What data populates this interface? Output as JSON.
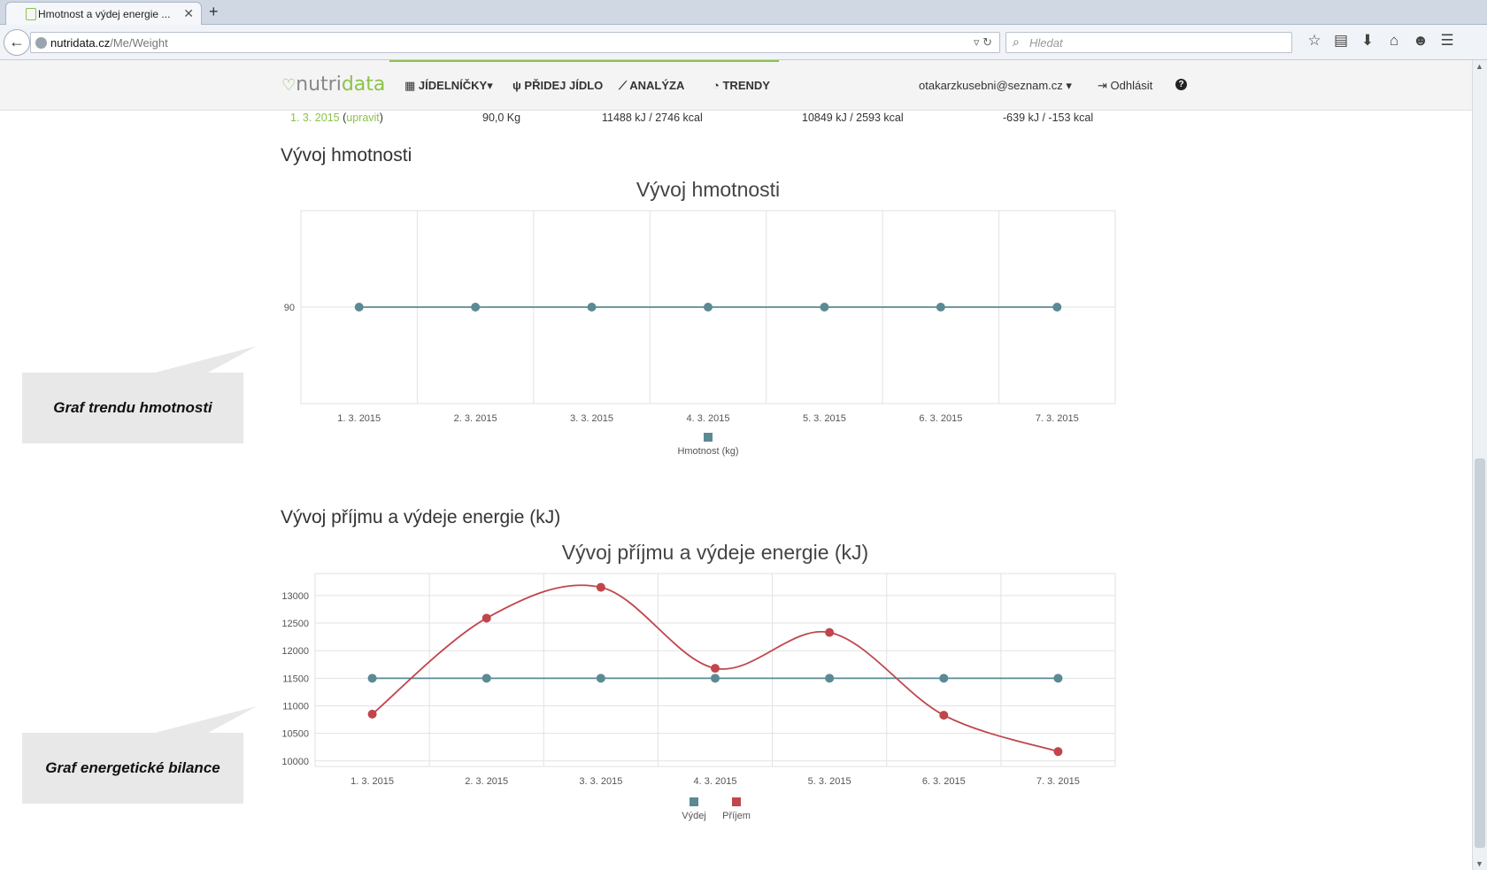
{
  "browser": {
    "tab_title": "Hmotnost a výdej energie ...",
    "tab_close": "✕",
    "new_tab": "+",
    "url_domain": "nutridata.cz",
    "url_path": "/Me/Weight",
    "search_placeholder": "Hledat"
  },
  "header": {
    "logo_text_1": "nutri",
    "logo_text_2": "data",
    "menu": [
      {
        "icon": "calendar-icon",
        "label": "JÍDELNÍČKY"
      },
      {
        "icon": "cutlery-icon",
        "label": "PŘIDEJ JÍDLO"
      },
      {
        "icon": "line-chart-icon",
        "label": "ANALÝZA"
      },
      {
        "icon": "dashboard-icon",
        "label": "TRENDY"
      }
    ],
    "user_email": "otakarzkusebni@seznam.cz",
    "logout_label": "Odhlásit",
    "help": "?"
  },
  "summary_row": {
    "date": "1. 3. 2015",
    "edit_label": "upravit",
    "weight": "90,0 Kg",
    "intake": "11488 kJ / 2746 kcal",
    "expenditure": "10849 kJ / 2593 kcal",
    "balance": "-639 kJ / -153 kcal"
  },
  "callouts": {
    "weight": "Graf trendu hmotnosti",
    "energy": "Graf energetické bilance"
  },
  "sections": {
    "weight_title": "Vývoj hmotnosti",
    "energy_title": "Vývoj příjmu a výdeje energie (kJ)"
  },
  "chart_data": [
    {
      "type": "line",
      "title": "Vývoj hmotnosti",
      "categories": [
        "1. 3. 2015",
        "2. 3. 2015",
        "3. 3. 2015",
        "4. 3. 2015",
        "5. 3. 2015",
        "6. 3. 2015",
        "7. 3. 2015"
      ],
      "yticks": [
        90
      ],
      "ylim": [
        80,
        100
      ],
      "series": [
        {
          "name": "Hmotnost (kg)",
          "color": "#5b8a94",
          "values": [
            90,
            90,
            90,
            90,
            90,
            90,
            90
          ]
        }
      ],
      "legend": "bottom",
      "grid": true
    },
    {
      "type": "line",
      "title": "Vývoj příjmu a výdeje energie (kJ)",
      "categories": [
        "1. 3. 2015",
        "2. 3. 2015",
        "3. 3. 2015",
        "4. 3. 2015",
        "5. 3. 2015",
        "6. 3. 2015",
        "7. 3. 2015"
      ],
      "yticks": [
        10000,
        10500,
        11000,
        11500,
        12000,
        12500,
        13000
      ],
      "ylim": [
        9900,
        13400
      ],
      "series": [
        {
          "name": "Výdej",
          "color": "#5b8a94",
          "values": [
            11500,
            11500,
            11500,
            11500,
            11500,
            11500,
            11500
          ]
        },
        {
          "name": "Příjem",
          "color": "#c0464c",
          "values": [
            10849,
            12590,
            13150,
            11680,
            12330,
            10830,
            10170
          ]
        }
      ],
      "legend": "bottom",
      "grid": true
    }
  ]
}
